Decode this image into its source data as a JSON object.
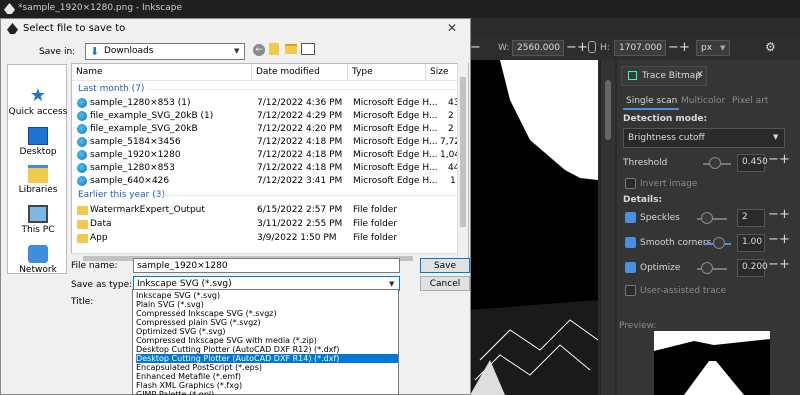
{
  "app": {
    "window_title": "*sample_1920×1280.png - Inkscape",
    "toolbar": {
      "w_label": "W:",
      "w_value": "2560.000",
      "h_label": "H:",
      "h_value": "1707.000",
      "unit": "px"
    }
  },
  "trace_panel": {
    "tab_title": "Trace Bitmap",
    "modes": [
      "Single scan",
      "Multicolor",
      "Pixel art"
    ],
    "detection_mode_label": "Detection mode:",
    "detection_mode_value": "Brightness cutoff",
    "threshold_label": "Threshold",
    "threshold_value": "0.450",
    "invert_label": "Invert image",
    "details_label": "Details:",
    "speckles_label": "Speckles",
    "speckles_value": "2",
    "smooth_label": "Smooth corners",
    "smooth_value": "1.00",
    "optimize_label": "Optimize",
    "optimize_value": "0.200",
    "user_assisted_label": "User-assisted trace",
    "preview_label": "Preview:"
  },
  "dialog": {
    "title": "Select file to save to",
    "save_in_label": "Save in:",
    "save_in_value": "Downloads",
    "places": [
      "Quick access",
      "Desktop",
      "Libraries",
      "This PC",
      "Network"
    ],
    "columns": [
      "Name",
      "Date modified",
      "Type",
      "Size"
    ],
    "groups": {
      "last_month": "Last month (7)",
      "earlier_year": "Earlier this year (3)"
    },
    "files": [
      {
        "name": "sample_1280×853 (1)",
        "date": "7/12/2022 4:36 PM",
        "type": "Microsoft Edge H...",
        "size": "43"
      },
      {
        "name": "file_example_SVG_20kB (1)",
        "date": "7/12/2022 4:29 PM",
        "type": "Microsoft Edge H...",
        "size": "2"
      },
      {
        "name": "file_example_SVG_20kB",
        "date": "7/12/2022 4:20 PM",
        "type": "Microsoft Edge H...",
        "size": "2"
      },
      {
        "name": "sample_5184×3456",
        "date": "7/12/2022 4:18 PM",
        "type": "Microsoft Edge H...",
        "size": "7,72"
      },
      {
        "name": "sample_1920×1280",
        "date": "7/12/2022 4:18 PM",
        "type": "Microsoft Edge H...",
        "size": "1,04"
      },
      {
        "name": "sample_1280×853",
        "date": "7/12/2022 4:18 PM",
        "type": "Microsoft Edge H...",
        "size": "44"
      },
      {
        "name": "sample_640×426",
        "date": "7/12/2022 3:41 PM",
        "type": "Microsoft Edge H...",
        "size": "1"
      }
    ],
    "folders": [
      {
        "name": "WatermarkExpert_Output",
        "date": "6/15/2022 2:57 PM",
        "type": "File folder"
      },
      {
        "name": "Data",
        "date": "3/11/2022 2:55 PM",
        "type": "File folder"
      },
      {
        "name": "App",
        "date": "3/9/2022 1:50 PM",
        "type": "File folder"
      }
    ],
    "file_name_label": "File name:",
    "file_name_value": "sample_1920×1280",
    "save_as_label": "Save as type:",
    "save_as_value": "Inkscape SVG (*.svg)",
    "title_label": "Title:",
    "save_button": "Save",
    "cancel_button": "Cancel",
    "type_options": [
      "Inkscape SVG (*.svg)",
      "Plain SVG (*.svg)",
      "Compressed Inkscape SVG (*.svgz)",
      "Compressed plain SVG (*.svgz)",
      "Optimized SVG (*.svg)",
      "Compressed Inkscape SVG with media (*.zip)",
      "Desktop Cutting Plotter (AutoCAD DXF R12) (*.dxf)",
      "Desktop Cutting Plotter (AutoCAD DXF R14) (*.dxf)",
      "Encapsulated PostScript (*.eps)",
      "Enhanced Metafile (*.emf)",
      "Flash XML Graphics (*.fxg)",
      "GIMP Palette (*.gpl)"
    ],
    "selected_option": "Desktop Cutting Plotter (AutoCAD DXF R14) (*.dxf)"
  }
}
